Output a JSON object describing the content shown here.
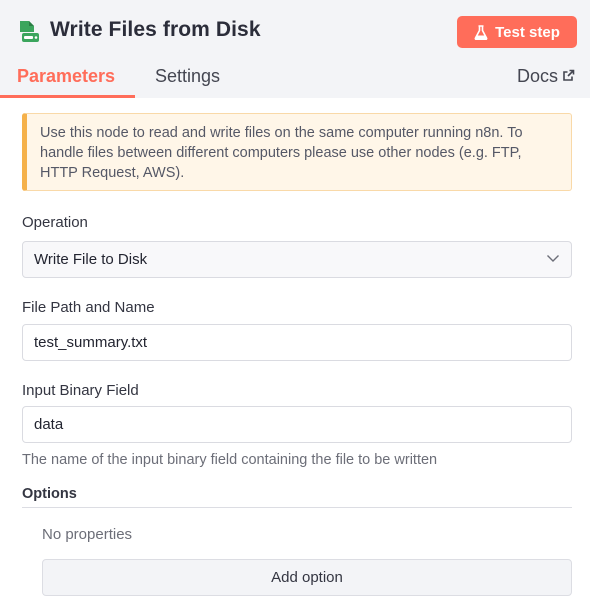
{
  "header": {
    "title": "Write Files from Disk",
    "node_icon": "file-disk-icon",
    "test_step_label": "Test step",
    "test_step_icon": "flask-icon",
    "accent_color": "#ff6d5a"
  },
  "tabs": [
    {
      "label": "Parameters",
      "active": true
    },
    {
      "label": "Settings",
      "active": false
    }
  ],
  "docs": {
    "label": "Docs",
    "icon": "external-link-icon"
  },
  "notice": {
    "text": "Use this node to read and write files on the same computer running n8n. To handle files between different computers please use other nodes (e.g. FTP, HTTP Request, AWS)."
  },
  "operation": {
    "label": "Operation",
    "value": "Write File to Disk"
  },
  "file_path": {
    "label": "File Path and Name",
    "value": "test_summary.txt"
  },
  "binary_field": {
    "label": "Input Binary Field",
    "value": "data",
    "hint": "The name of the input binary field containing the file to be written"
  },
  "options": {
    "title": "Options",
    "empty_text": "No properties",
    "add_label": "Add option"
  }
}
